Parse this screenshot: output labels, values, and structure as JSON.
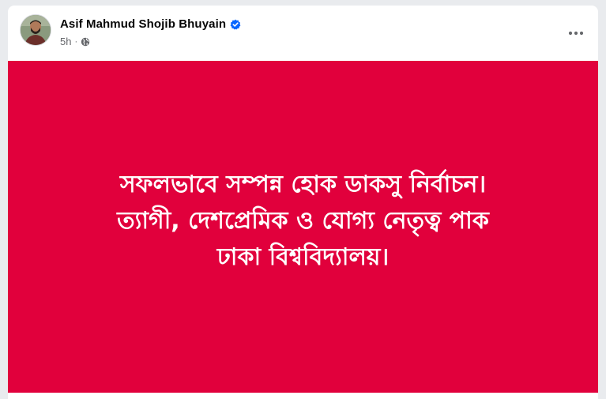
{
  "post": {
    "author": {
      "name": "Asif Mahmud Shojib Bhuyain",
      "verified": true,
      "avatar_icon": "profile-photo"
    },
    "timestamp": "5h",
    "separator": "·",
    "audience_icon": "globe-icon",
    "more_icon": "more-horizontal-icon",
    "image": {
      "background_color": "#e1003c",
      "text_color": "#ffffff",
      "lines": [
        "সফলভাবে সম্পন্ন হোক ডাকসু নির্বাচন।",
        "ত্যাগী, দেশপ্রেমিক ও যোগ্য নেতৃত্ব পাক",
        "ঢাকা বিশ্ববিদ্যালয়।"
      ]
    }
  },
  "colors": {
    "verified_blue": "#0866ff",
    "secondary_text": "#65676b",
    "primary_text": "#050505"
  }
}
